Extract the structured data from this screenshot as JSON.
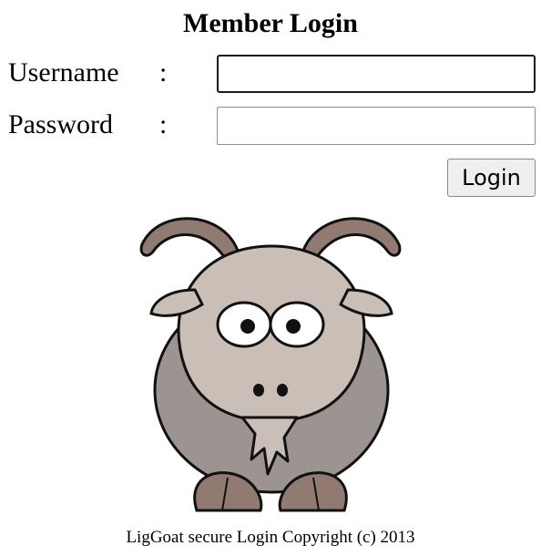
{
  "page": {
    "title": "Member Login",
    "footer": "LigGoat secure Login Copyright (c) 2013"
  },
  "form": {
    "username": {
      "label": "Username",
      "separator": ":",
      "value": ""
    },
    "password": {
      "label": "Password",
      "separator": ":",
      "value": ""
    },
    "submit_label": "Login"
  },
  "image": {
    "subject": "goat-cartoon",
    "colors": {
      "fur": "#c9bfb7",
      "fur_shadow": "#9c9490",
      "horn": "#907a72",
      "outline": "#111111"
    }
  }
}
